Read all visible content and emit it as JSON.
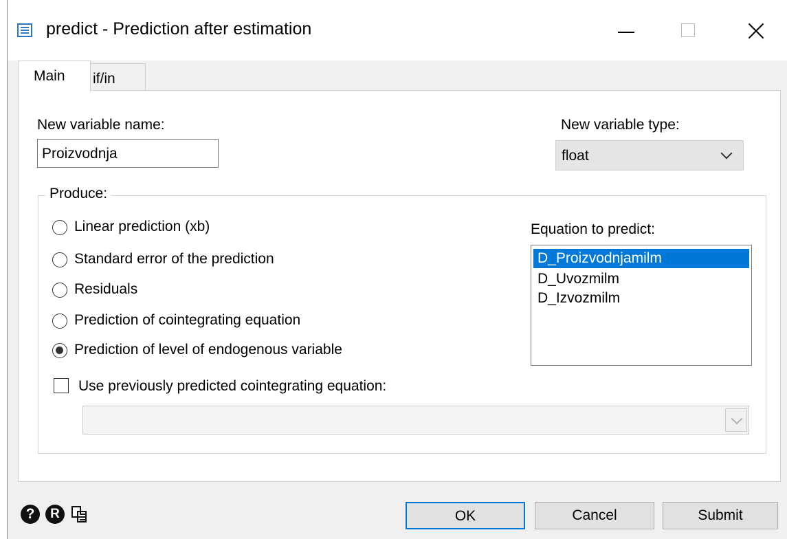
{
  "window": {
    "title": "predict - Prediction after estimation",
    "icon": "dialog-icon"
  },
  "tabs": [
    {
      "label": "Main",
      "active": true
    },
    {
      "label": "if/in",
      "active": false
    }
  ],
  "main": {
    "new_var_label": "New variable name:",
    "new_var_value": "Proizvodnja",
    "var_type_label": "New variable type:",
    "var_type_value": "float",
    "produce_label": "Produce:",
    "radio_options": [
      {
        "label": "Linear prediction (xb)",
        "selected": false
      },
      {
        "label": "Standard error of the prediction",
        "selected": false
      },
      {
        "label": "Residuals",
        "selected": false
      },
      {
        "label": "Prediction of cointegrating equation",
        "selected": false
      },
      {
        "label": "Prediction of level of endogenous variable",
        "selected": true
      }
    ],
    "equation_label": "Equation to predict:",
    "equations": [
      {
        "label": "D_Proizvodnjamilm",
        "selected": true
      },
      {
        "label": "D_Uvozmilm",
        "selected": false
      },
      {
        "label": "D_Izvozmilm",
        "selected": false
      }
    ],
    "checkbox_label": "Use previously predicted cointegrating equation:",
    "checkbox_checked": false,
    "ce_select_value": ""
  },
  "footer": {
    "help_glyph": "?",
    "reset_glyph": "R",
    "ok_label": "OK",
    "cancel_label": "Cancel",
    "submit_label": "Submit"
  },
  "colors": {
    "accent": "#0078d7",
    "dialog_bg": "#f0f0f0",
    "panel_bg": "#ffffff"
  }
}
